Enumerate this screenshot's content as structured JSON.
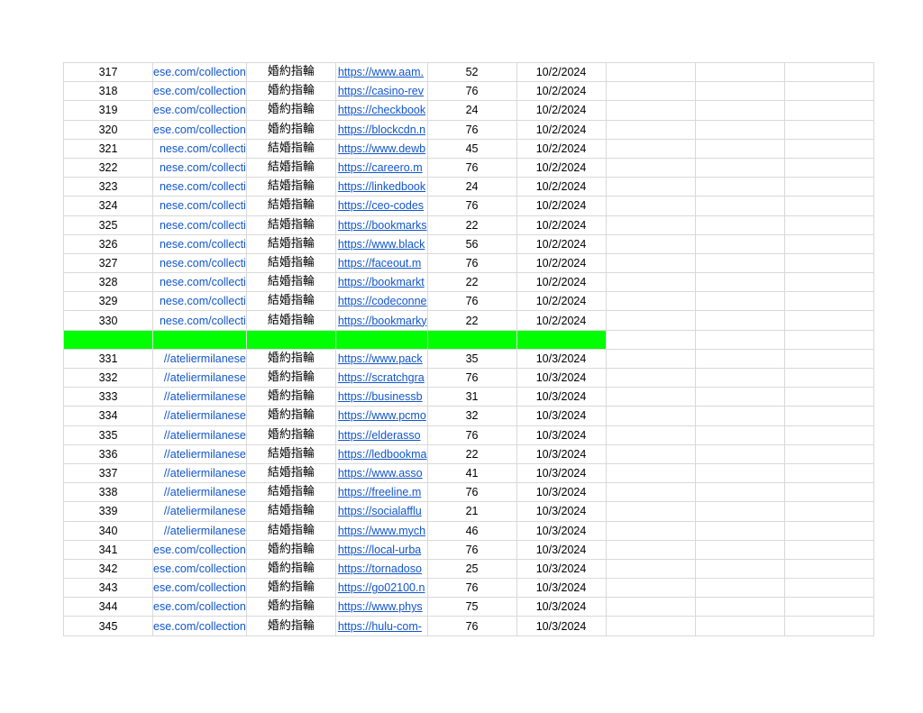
{
  "colors": {
    "link": "#1155cc",
    "separator_fill": "#00ff00",
    "gridline": "#d9d9d9"
  },
  "rows_top": [
    {
      "num": "317",
      "url1": "ese.com/collection",
      "kw": "婚約指輪",
      "url2": "https://www.aam.",
      "val": "52",
      "date": "10/2/2024"
    },
    {
      "num": "318",
      "url1": "ese.com/collection",
      "kw": "婚約指輪",
      "url2": "https://casino-rev",
      "val": "76",
      "date": "10/2/2024"
    },
    {
      "num": "319",
      "url1": "ese.com/collection",
      "kw": "婚約指輪",
      "url2": "https://checkbook",
      "val": "24",
      "date": "10/2/2024"
    },
    {
      "num": "320",
      "url1": "ese.com/collection",
      "kw": "婚約指輪",
      "url2": "https://blockcdn.n",
      "val": "76",
      "date": "10/2/2024"
    },
    {
      "num": "321",
      "url1": "nese.com/collecti",
      "kw": "結婚指輪",
      "url2": "https://www.dewb",
      "val": "45",
      "date": "10/2/2024"
    },
    {
      "num": "322",
      "url1": "nese.com/collecti",
      "kw": "結婚指輪",
      "url2": "https://careero.m",
      "val": "76",
      "date": "10/2/2024"
    },
    {
      "num": "323",
      "url1": "nese.com/collecti",
      "kw": "結婚指輪",
      "url2": "https://linkedbook",
      "val": "24",
      "date": "10/2/2024"
    },
    {
      "num": "324",
      "url1": "nese.com/collecti",
      "kw": "結婚指輪",
      "url2": "https://ceo-codes",
      "val": "76",
      "date": "10/2/2024"
    },
    {
      "num": "325",
      "url1": "nese.com/collecti",
      "kw": "結婚指輪",
      "url2": "https://bookmarks",
      "val": "22",
      "date": "10/2/2024"
    },
    {
      "num": "326",
      "url1": "nese.com/collecti",
      "kw": "結婚指輪",
      "url2": "https://www.black",
      "val": "56",
      "date": "10/2/2024"
    },
    {
      "num": "327",
      "url1": "nese.com/collecti",
      "kw": "結婚指輪",
      "url2": "https://faceout.m",
      "val": "76",
      "date": "10/2/2024"
    },
    {
      "num": "328",
      "url1": "nese.com/collecti",
      "kw": "結婚指輪",
      "url2": "https://bookmarkt",
      "val": "22",
      "date": "10/2/2024"
    },
    {
      "num": "329",
      "url1": "nese.com/collecti",
      "kw": "結婚指輪",
      "url2": "https://codeconne",
      "val": "76",
      "date": "10/2/2024"
    },
    {
      "num": "330",
      "url1": "nese.com/collecti",
      "kw": "結婚指輪",
      "url2": "https://bookmarky",
      "val": "22",
      "date": "10/2/2024"
    }
  ],
  "rows_bottom": [
    {
      "num": "331",
      "url1": "//ateliermilanese",
      "kw": "婚約指輪",
      "url2": "https://www.pack",
      "val": "35",
      "date": "10/3/2024"
    },
    {
      "num": "332",
      "url1": "//ateliermilanese",
      "kw": "婚約指輪",
      "url2": "https://scratchgra",
      "val": "76",
      "date": "10/3/2024"
    },
    {
      "num": "333",
      "url1": "//ateliermilanese",
      "kw": "婚約指輪",
      "url2": "https://businessb",
      "val": "31",
      "date": "10/3/2024"
    },
    {
      "num": "334",
      "url1": "//ateliermilanese",
      "kw": "婚約指輪",
      "url2": "https://www.pcmo",
      "val": "32",
      "date": "10/3/2024"
    },
    {
      "num": "335",
      "url1": "//ateliermilanese",
      "kw": "婚約指輪",
      "url2": "https://elderasso",
      "val": "76",
      "date": "10/3/2024"
    },
    {
      "num": "336",
      "url1": "//ateliermilanese",
      "kw": "結婚指輪",
      "url2": "https://ledbookma",
      "val": "22",
      "date": "10/3/2024"
    },
    {
      "num": "337",
      "url1": "//ateliermilanese",
      "kw": "結婚指輪",
      "url2": "https://www.asso",
      "val": "41",
      "date": "10/3/2024"
    },
    {
      "num": "338",
      "url1": "//ateliermilanese",
      "kw": "結婚指輪",
      "url2": "https://freeline.m",
      "val": "76",
      "date": "10/3/2024"
    },
    {
      "num": "339",
      "url1": "//ateliermilanese",
      "kw": "結婚指輪",
      "url2": "https://socialafflu",
      "val": "21",
      "date": "10/3/2024"
    },
    {
      "num": "340",
      "url1": "//ateliermilanese",
      "kw": "結婚指輪",
      "url2": "https://www.mych",
      "val": "46",
      "date": "10/3/2024"
    },
    {
      "num": "341",
      "url1": "ese.com/collection",
      "kw": "婚約指輪",
      "url2": "https://local-urba",
      "val": "76",
      "date": "10/3/2024"
    },
    {
      "num": "342",
      "url1": "ese.com/collection",
      "kw": "婚約指輪",
      "url2": "https://tornadoso",
      "val": "25",
      "date": "10/3/2024"
    },
    {
      "num": "343",
      "url1": "ese.com/collection",
      "kw": "婚約指輪",
      "url2": "https://go02100.n",
      "val": "76",
      "date": "10/3/2024"
    },
    {
      "num": "344",
      "url1": "ese.com/collection",
      "kw": "婚約指輪",
      "url2": "https://www.phys",
      "val": "75",
      "date": "10/3/2024"
    },
    {
      "num": "345",
      "url1": "ese.com/collection",
      "kw": "婚約指輪",
      "url2": "https://hulu-com-",
      "val": "76",
      "date": "10/3/2024"
    }
  ]
}
